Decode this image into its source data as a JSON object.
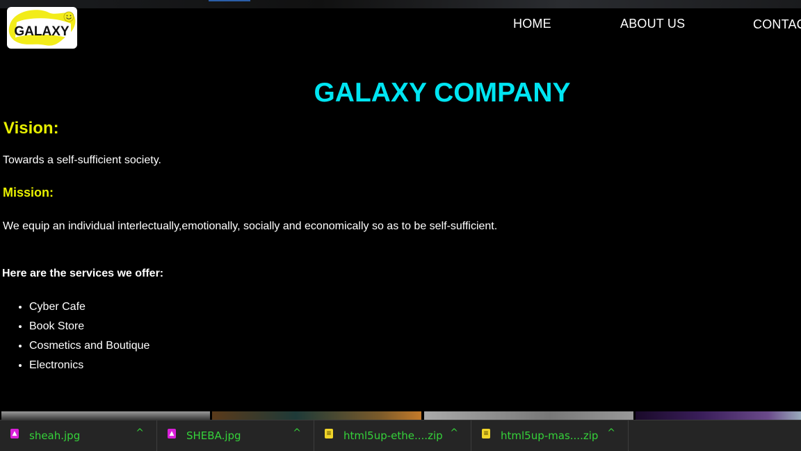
{
  "logo": {
    "text": "GALAXY",
    "icon": "smiley-logo"
  },
  "nav": {
    "items": [
      "HOME",
      "ABOUT US",
      "CONTACT"
    ]
  },
  "main": {
    "title": "GALAXY COMPANY",
    "vision": {
      "heading": "Vision:",
      "text": "Towards a self-sufficient society."
    },
    "mission": {
      "heading": "Mission:",
      "text": "We equip an individual interlectually,emotionally, socially and economically so as to be self-sufficient."
    },
    "services": {
      "heading": "Here are the services we offer:",
      "items": [
        "Cyber Cafe",
        "Book Store",
        "Cosmetics and Boutique",
        "Electronics"
      ]
    }
  },
  "downloads": {
    "items": [
      {
        "name": "sheah.jpg",
        "type": "image-file-icon"
      },
      {
        "name": "SHEBA.jpg",
        "type": "image-file-icon"
      },
      {
        "name": "html5up-ethe....zip",
        "type": "zip-file-icon"
      },
      {
        "name": "html5up-mas....zip",
        "type": "zip-file-icon"
      }
    ],
    "chevron": "^"
  },
  "colors": {
    "background": "#000000",
    "title": "#00e5f2",
    "headings": "#e8f000",
    "download_text": "#35d23a",
    "download_bar": "#252525"
  }
}
